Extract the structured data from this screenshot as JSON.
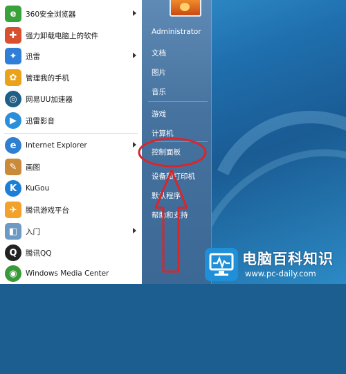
{
  "left_menu": {
    "items": [
      {
        "label": "360安全浏览器",
        "icon": "360-browser-icon",
        "color": "#3aa23a",
        "glyph": "e",
        "submenu": true
      },
      {
        "label": "强力卸载电脑上的软件",
        "icon": "uninstall-icon",
        "color": "#d9502e",
        "glyph": "✚",
        "submenu": false
      },
      {
        "label": "迅雷",
        "icon": "thunder-icon",
        "color": "#2f7fd8",
        "glyph": "✦",
        "submenu": true
      },
      {
        "label": "管理我的手机",
        "icon": "phone-manager-icon",
        "color": "#e9a21a",
        "glyph": "✿",
        "submenu": false
      },
      {
        "label": "网易UU加速器",
        "icon": "uu-accelerator-icon",
        "color": "#1f5f86",
        "glyph": "◎",
        "submenu": false
      },
      {
        "label": "迅雷影音",
        "icon": "thunder-player-icon",
        "color": "#2a8fd8",
        "glyph": "▶",
        "submenu": false
      },
      {
        "label": "Internet Explorer",
        "icon": "ie-icon",
        "color": "#2e7fd0",
        "glyph": "e",
        "submenu": true
      },
      {
        "label": "画图",
        "icon": "paint-icon",
        "color": "#c98a3a",
        "glyph": "✎",
        "submenu": false
      },
      {
        "label": "KuGou",
        "icon": "kugou-icon",
        "color": "#1c7fd6",
        "glyph": "K",
        "submenu": false
      },
      {
        "label": "腾讯游戏平台",
        "icon": "tencent-games-icon",
        "color": "#f2a12b",
        "glyph": "✈",
        "submenu": false
      },
      {
        "label": "入门",
        "icon": "getting-started-icon",
        "color": "#6c9ac4",
        "glyph": "◧",
        "submenu": true
      },
      {
        "label": "腾讯QQ",
        "icon": "qq-icon",
        "color": "#222222",
        "glyph": "Q",
        "submenu": false
      },
      {
        "label": "Windows Media Center",
        "icon": "media-center-icon",
        "color": "#3a9a3a",
        "glyph": "◉",
        "submenu": false
      }
    ]
  },
  "right_menu": {
    "items": [
      {
        "label": "Administrator"
      },
      {
        "label": "文档"
      },
      {
        "label": "图片"
      },
      {
        "label": "音乐"
      },
      {
        "label": "游戏"
      },
      {
        "label": "计算机"
      },
      {
        "label": "控制面板"
      },
      {
        "label": "设备和打印机"
      },
      {
        "label": "默认程序"
      },
      {
        "label": "帮助和支持"
      }
    ]
  },
  "annotation": {
    "color": "#d9262a"
  },
  "watermark": {
    "title": "电脑百科知识",
    "url": "www.pc-daily.com"
  }
}
